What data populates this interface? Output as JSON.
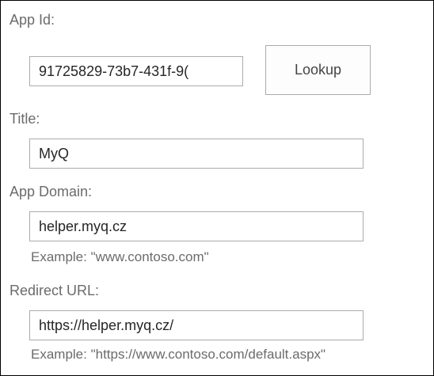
{
  "form": {
    "app_id": {
      "label": "App Id:",
      "value": "91725829-73b7-431f-9("
    },
    "lookup_button": {
      "label": "Lookup"
    },
    "title": {
      "label": "Title:",
      "value": "MyQ"
    },
    "app_domain": {
      "label": "App Domain:",
      "value": "helper.myq.cz",
      "example": "Example: \"www.contoso.com\""
    },
    "redirect_url": {
      "label": "Redirect URL:",
      "value": "https://helper.myq.cz/",
      "example": "Example: \"https://www.contoso.com/default.aspx\""
    }
  }
}
